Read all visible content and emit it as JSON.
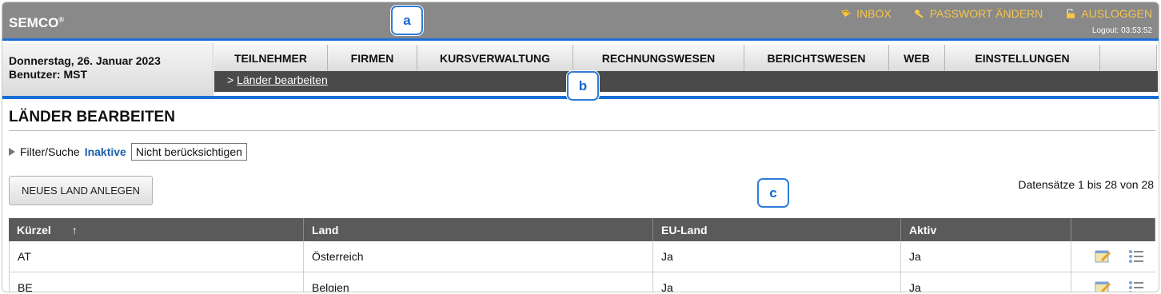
{
  "app": {
    "logo": "SEMCO",
    "logo_mark": "®"
  },
  "toplinks": {
    "inbox": "INBOX",
    "password": "PASSWORT ÄNDERN",
    "logout": "AUSLOGGEN",
    "logout_timer": "Logout: 03:53:52"
  },
  "badges": {
    "a": "a",
    "b": "b",
    "c": "c"
  },
  "session": {
    "date": "Donnerstag, 26. Januar 2023",
    "user": "Benutzer: MST"
  },
  "menu": [
    {
      "label": "TEILNEHMER"
    },
    {
      "label": "FIRMEN"
    },
    {
      "label": "KURSVERWALTUNG"
    },
    {
      "label": "RECHNUNGSWESEN"
    },
    {
      "label": "BERICHTSWESEN"
    },
    {
      "label": "WEB"
    },
    {
      "label": "EINSTELLUNGEN"
    },
    {
      "label": ""
    }
  ],
  "breadcrumb": {
    "prefix": ">",
    "link": "Länder bearbeiten"
  },
  "page": {
    "title": "LÄNDER BEARBEITEN"
  },
  "filter": {
    "label": "Filter/Suche",
    "state": "Inaktive",
    "select_value": "Nicht berücksichtigen"
  },
  "actions": {
    "new_label": "NEUES LAND ANLEGEN"
  },
  "records": "Datensätze 1 bis 28 von 28",
  "table": {
    "headers": {
      "kuerzel": "Kürzel",
      "sort": "↑",
      "land": "Land",
      "eu": "EU-Land",
      "aktiv": "Aktiv"
    },
    "rows": [
      {
        "kuerzel": "AT",
        "land": "Österreich",
        "eu": "Ja",
        "aktiv": "Ja"
      },
      {
        "kuerzel": "BE",
        "land": "Belgien",
        "eu": "Ja",
        "aktiv": "Ja"
      }
    ]
  },
  "colors": {
    "accent": "#1a6fd6",
    "toplink": "#f7c548",
    "header_bg": "#898989",
    "table_head": "#5a5a5a"
  }
}
